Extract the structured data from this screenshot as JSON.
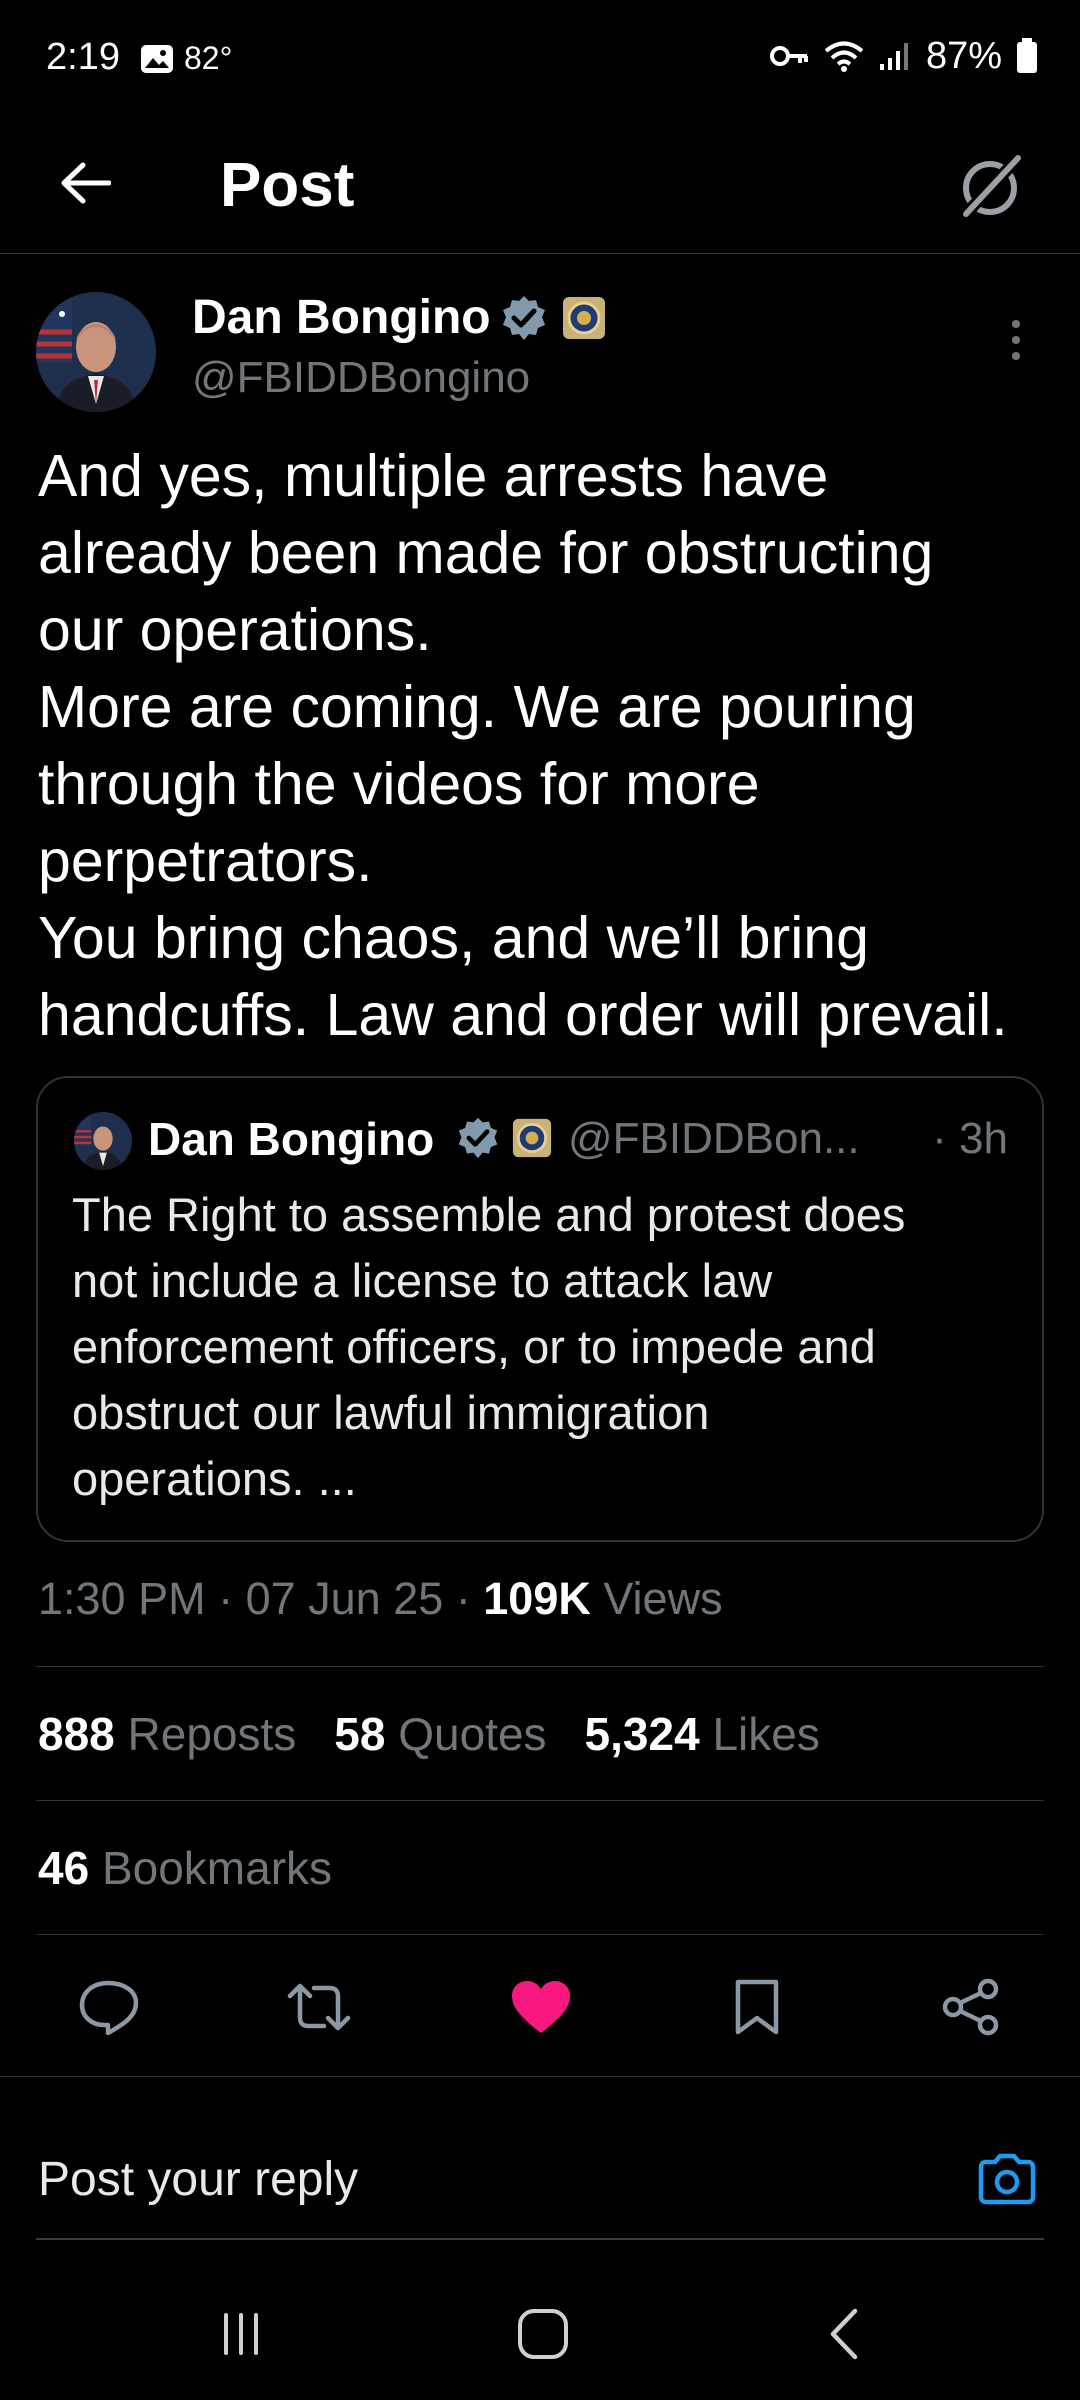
{
  "status_bar": {
    "time": "2:19",
    "temperature": "82°",
    "battery": "87%",
    "icons": [
      "gallery-icon",
      "key-icon",
      "wifi-icon",
      "signal-icon",
      "battery-icon"
    ]
  },
  "header": {
    "title": "Post",
    "back_icon": "arrow-left-icon",
    "grok_icon": "grok-icon"
  },
  "post": {
    "author_name": "Dan Bongino",
    "author_handle": "@FBIDDBongino",
    "lines": [
      "And yes, multiple arrests have",
      "already been made for obstructing",
      "our operations.",
      "More are coming. We are pouring",
      "through the videos for more",
      "perpetrators.",
      "You bring chaos, and we’ll bring",
      "handcuffs. Law and order will prevail."
    ],
    "quote": {
      "author_name": "Dan Bongino",
      "author_handle": "@FBIDDBon...",
      "time": "· 3h",
      "lines": [
        "The Right to assemble and protest does",
        "not include a license to attack law",
        "enforcement officers, or to impede and",
        "obstruct our lawful immigration",
        "operations. ..."
      ]
    },
    "meta": {
      "time": "1:30 PM",
      "sep1": " · ",
      "date": "07 Jun 25",
      "sep2": " · ",
      "views_count": "109K",
      "views_label": " Views"
    },
    "stats": {
      "reposts_count": "888",
      "reposts_label": " Reposts",
      "quotes_count": "58",
      "quotes_label": " Quotes",
      "likes_count": "5,324",
      "likes_label": " Likes",
      "bookmarks_count": "46",
      "bookmarks_label": " Bookmarks"
    }
  },
  "actions": {
    "items": [
      "reply-icon",
      "repost-icon",
      "like-icon",
      "bookmark-icon",
      "share-icon"
    ],
    "like_color": "#f91880"
  },
  "reply": {
    "placeholder": "Post your reply",
    "camera_color": "#1d9bf0"
  },
  "colors": {
    "background": "#000000",
    "text": "#e7e9ea",
    "muted": "#71767b",
    "divider": "#2f3336",
    "verified": "#829aab"
  }
}
